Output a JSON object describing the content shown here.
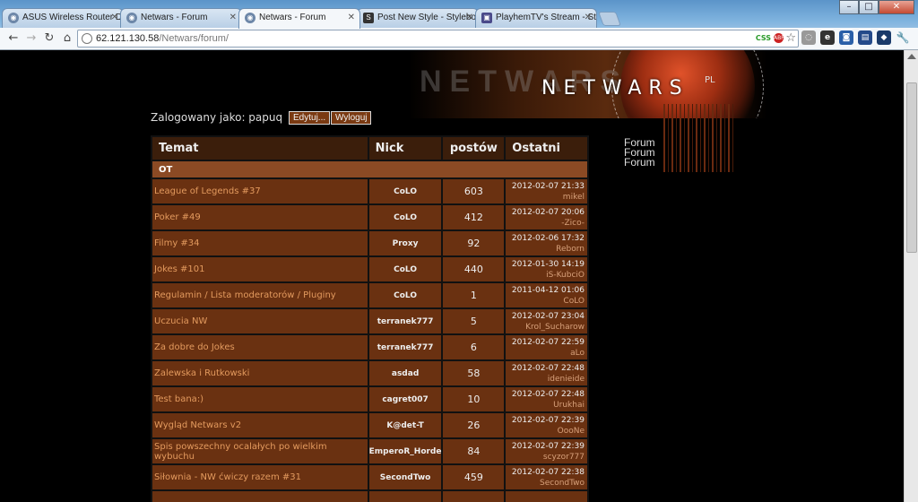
{
  "browser": {
    "tabs": [
      {
        "title": "ASUS Wireless Router DSL-N",
        "icon": "asus-icon",
        "active": false
      },
      {
        "title": "Netwars - Forum",
        "icon": "globe-icon",
        "active": false
      },
      {
        "title": "Netwars - Forum",
        "icon": "globe-icon",
        "active": true
      },
      {
        "title": "Post New Style - Stylebot Sty",
        "icon": "stylebot-icon",
        "active": false
      },
      {
        "title": "PlayhemTV's Stream - Starc",
        "icon": "twitch-icon",
        "active": false
      }
    ],
    "url_host": "62.121.130.58",
    "url_path": "/Netwars/forum/",
    "css_badge": "CSS",
    "abp_badge": "ABP"
  },
  "page": {
    "logo_text": "NETWARS",
    "logo_suffix": "PL",
    "login_label": "Zalogowany jako: papuq",
    "edit_button": "Edytuj...",
    "logout_button": "Wyloguj",
    "side_links": [
      "Forum",
      "Forum",
      "Forum"
    ],
    "table": {
      "headers": [
        "Temat",
        "Nick",
        "postów",
        "Ostatni"
      ],
      "section": "OT",
      "rows": [
        {
          "topic": "League of Legends #37",
          "nick": "CoLO",
          "posts": "603",
          "date": "2012-02-07 21:33",
          "user": "mikel"
        },
        {
          "topic": "Poker #49",
          "nick": "CoLO",
          "posts": "412",
          "date": "2012-02-07 20:06",
          "user": "-Zico-"
        },
        {
          "topic": "Filmy #34",
          "nick": "Proxy",
          "posts": "92",
          "date": "2012-02-06 17:32",
          "user": "Reborn"
        },
        {
          "topic": "Jokes #101",
          "nick": "CoLO",
          "posts": "440",
          "date": "2012-01-30 14:19",
          "user": "iS-KubciO"
        },
        {
          "topic": "Regulamin / Lista moderatorów / Pluginy",
          "nick": "CoLO",
          "posts": "1",
          "date": "2011-04-12 01:06",
          "user": "CoLO"
        },
        {
          "topic": "Uczucia NW",
          "nick": "terranek777",
          "posts": "5",
          "date": "2012-02-07 23:04",
          "user": "Krol_Sucharow"
        },
        {
          "topic": "Za dobre do Jokes",
          "nick": "terranek777",
          "posts": "6",
          "date": "2012-02-07 22:59",
          "user": "aLo"
        },
        {
          "topic": "Zalewska i Rutkowski",
          "nick": "asdad",
          "posts": "58",
          "date": "2012-02-07 22:48",
          "user": "idenieide"
        },
        {
          "topic": "Test bana:)",
          "nick": "cagret007",
          "posts": "10",
          "date": "2012-02-07 22:48",
          "user": "Urukhai"
        },
        {
          "topic": "Wygląd Netwars v2",
          "nick": "K@det-T",
          "posts": "26",
          "date": "2012-02-07 22:39",
          "user": "OooNe"
        },
        {
          "topic": "Spis powszechny ocalałych po wielkim wybuchu",
          "nick": "EmperoR_Horde",
          "posts": "84",
          "date": "2012-02-07 22:39",
          "user": "scyzor777"
        },
        {
          "topic": "Siłownia - NW ćwiczy razem #31",
          "nick": "SecondTwo",
          "posts": "459",
          "date": "2012-02-07 22:38",
          "user": "SecondTwo"
        },
        {
          "topic": "",
          "nick": "",
          "posts": "",
          "date": "",
          "user": ""
        }
      ]
    }
  }
}
